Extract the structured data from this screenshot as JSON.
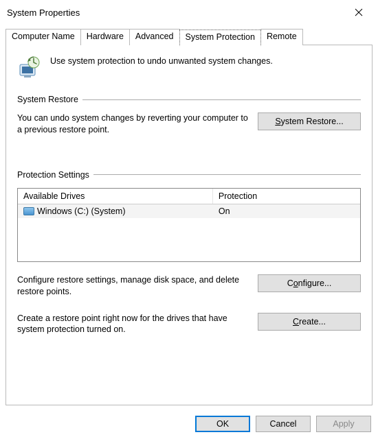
{
  "window": {
    "title": "System Properties"
  },
  "tabs": {
    "computer_name": "Computer Name",
    "hardware": "Hardware",
    "advanced": "Advanced",
    "system_protection": "System Protection",
    "remote": "Remote"
  },
  "intro": {
    "text": "Use system protection to undo unwanted system changes."
  },
  "restore": {
    "group_label": "System Restore",
    "description": "You can undo system changes by reverting your computer to a previous restore point.",
    "button_prefix": "S",
    "button_suffix": "ystem Restore..."
  },
  "protection": {
    "group_label": "Protection Settings",
    "col_drives": "Available Drives",
    "col_protection": "Protection",
    "drives": [
      {
        "name": "Windows (C:) (System)",
        "status": "On"
      }
    ],
    "configure_desc": "Configure restore settings, manage disk space, and delete restore points.",
    "configure_prefix": "C",
    "configure_mid": "o",
    "configure_suffix": "nfigure...",
    "create_desc": "Create a restore point right now for the drives that have system protection turned on.",
    "create_prefix": "C",
    "create_suffix": "reate..."
  },
  "footer": {
    "ok": "OK",
    "cancel": "Cancel",
    "apply": "Apply"
  }
}
